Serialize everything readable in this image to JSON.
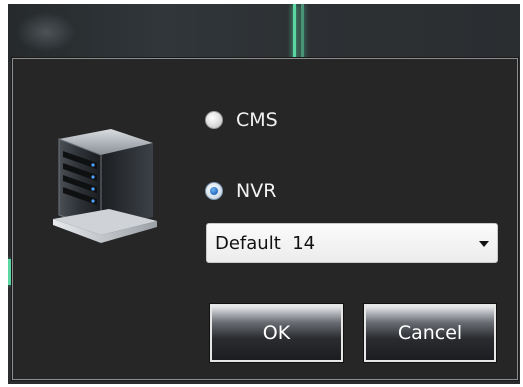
{
  "dialog": {
    "options": [
      {
        "label": "CMS",
        "selected": false
      },
      {
        "label": "NVR",
        "selected": true
      }
    ],
    "device_select": {
      "value": "Default  14"
    },
    "buttons": {
      "ok": "OK",
      "cancel": "Cancel"
    },
    "icon": "server-tower-icon"
  },
  "colors": {
    "dialog_bg": "#262626",
    "accent_line": "#5bd7a3",
    "radio_selected": "#2f74c8"
  }
}
